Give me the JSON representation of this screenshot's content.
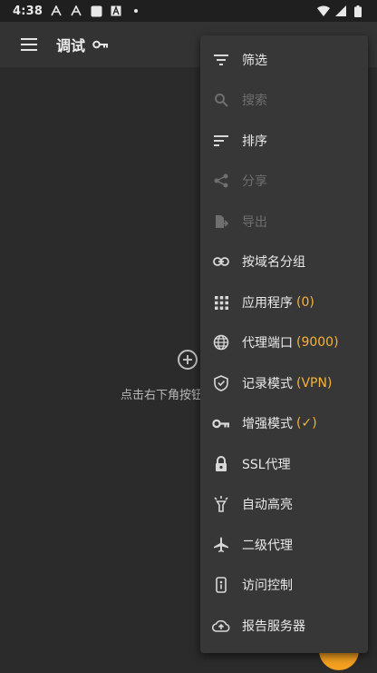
{
  "status_bar": {
    "time": "4:38",
    "notif_icons": [
      "font-a-icon",
      "font-a-icon",
      "square-app-icon",
      "a-box-icon",
      "dot-icon"
    ],
    "right_icons": [
      "wifi-icon",
      "signal-icon",
      "battery-icon"
    ]
  },
  "app_bar": {
    "title": "调试",
    "menu_icon": "hamburger-icon",
    "title_icon": "key-icon"
  },
  "empty_state": {
    "icon": "add-circle-icon",
    "text": "点击右下角按钮"
  },
  "fab": {
    "color": "#f3a01f"
  },
  "menu": {
    "accent_color": "#f4b43c",
    "items": [
      {
        "label": "筛选",
        "icon": "filter-icon",
        "enabled": true
      },
      {
        "label": "搜索",
        "icon": "search-icon",
        "enabled": false
      },
      {
        "label": "排序",
        "icon": "sort-icon",
        "enabled": true
      },
      {
        "label": "分享",
        "icon": "share-icon",
        "enabled": false
      },
      {
        "label": "导出",
        "icon": "export-icon",
        "enabled": false
      },
      {
        "label": "按域名分组",
        "icon": "link-icon",
        "enabled": true
      },
      {
        "label": "应用程序",
        "value": "(0)",
        "icon": "apps-grid-icon",
        "enabled": true
      },
      {
        "label": "代理端口",
        "value": "(9000)",
        "icon": "globe-icon",
        "enabled": true
      },
      {
        "label": "记录模式",
        "value": "(VPN)",
        "icon": "shield-icon",
        "enabled": true
      },
      {
        "label": "增强模式",
        "value": "(✓)",
        "icon": "key-icon",
        "enabled": true
      },
      {
        "label": "SSL代理",
        "icon": "lock-icon",
        "enabled": true
      },
      {
        "label": "自动高亮",
        "icon": "highlight-icon",
        "enabled": true
      },
      {
        "label": "二级代理",
        "icon": "airplane-icon",
        "enabled": true
      },
      {
        "label": "访问控制",
        "icon": "access-control-icon",
        "enabled": true
      },
      {
        "label": "报告服务器",
        "icon": "cloud-upload-icon",
        "enabled": true
      }
    ]
  }
}
